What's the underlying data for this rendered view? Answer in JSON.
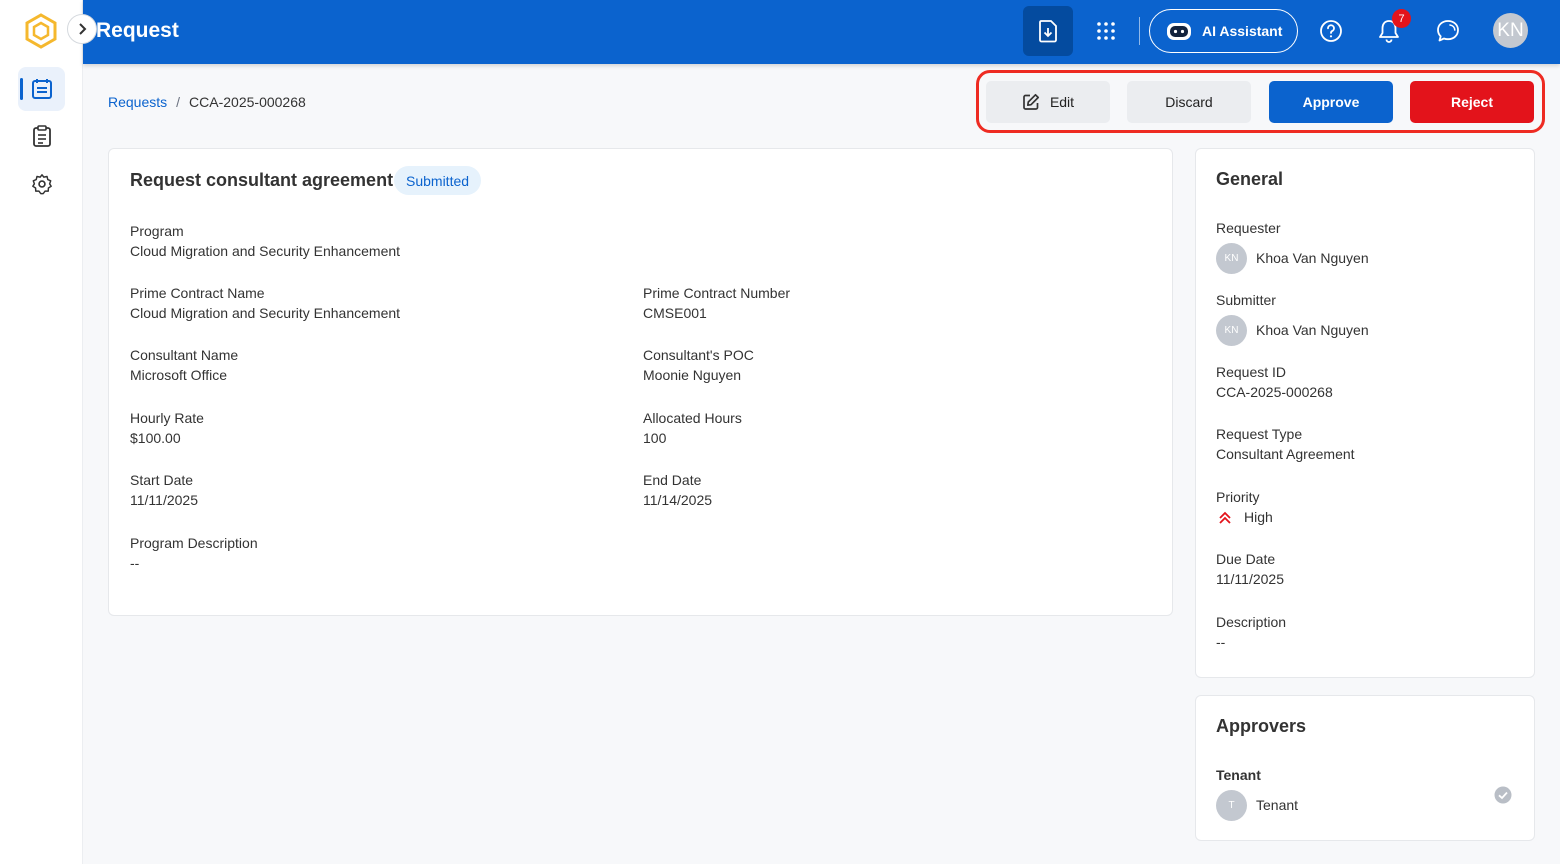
{
  "app": {
    "title": "Request",
    "ai_assistant_label": "AI Assistant",
    "notification_count": "7",
    "user_initials": "KN"
  },
  "icons": {
    "logo": "hexagon-logo-icon",
    "sidebar": [
      "calendar-list-icon",
      "clipboard-list-icon",
      "gear-icon"
    ],
    "topbar": [
      "download-file-icon",
      "apps-grid-icon",
      "robot-icon",
      "help-icon",
      "bell-icon",
      "chat-icon"
    ]
  },
  "breadcrumb": {
    "parent": "Requests",
    "separator": "/",
    "current": "CCA-2025-000268"
  },
  "actions": {
    "edit": "Edit",
    "discard": "Discard",
    "approve": "Approve",
    "reject": "Reject"
  },
  "main": {
    "title": "Request consultant agreement",
    "status": "Submitted",
    "fields": {
      "program": {
        "label": "Program",
        "value": "Cloud Migration and Security Enhancement"
      },
      "prime_contract_name": {
        "label": "Prime Contract Name",
        "value": "Cloud Migration and Security Enhancement"
      },
      "prime_contract_number": {
        "label": "Prime Contract Number",
        "value": "CMSE001"
      },
      "consultant_name": {
        "label": "Consultant Name",
        "value": "Microsoft Office"
      },
      "consultant_poc": {
        "label": "Consultant's POC",
        "value": "Moonie Nguyen"
      },
      "hourly_rate": {
        "label": "Hourly Rate",
        "value": "$100.00"
      },
      "allocated_hours": {
        "label": "Allocated Hours",
        "value": "100"
      },
      "start_date": {
        "label": "Start Date",
        "value": "11/11/2025"
      },
      "end_date": {
        "label": "End Date",
        "value": "11/14/2025"
      },
      "program_description": {
        "label": "Program Description",
        "value": "--"
      }
    }
  },
  "general": {
    "title": "General",
    "requester": {
      "label": "Requester",
      "initials": "KN",
      "name": "Khoa Van Nguyen"
    },
    "submitter": {
      "label": "Submitter",
      "initials": "KN",
      "name": "Khoa Van Nguyen"
    },
    "request_id": {
      "label": "Request ID",
      "value": "CCA-2025-000268"
    },
    "request_type": {
      "label": "Request Type",
      "value": "Consultant Agreement"
    },
    "priority": {
      "label": "Priority",
      "value": "High"
    },
    "due_date": {
      "label": "Due Date",
      "value": "11/11/2025"
    },
    "description": {
      "label": "Description",
      "value": "--"
    }
  },
  "approvers": {
    "title": "Approvers",
    "group_label": "Tenant",
    "initials": "T",
    "name": "Tenant"
  },
  "colors": {
    "brand": "#0b63ce",
    "reject": "#e3131b",
    "highlight": "#ee2b22",
    "priority_high": "#e3131b"
  }
}
